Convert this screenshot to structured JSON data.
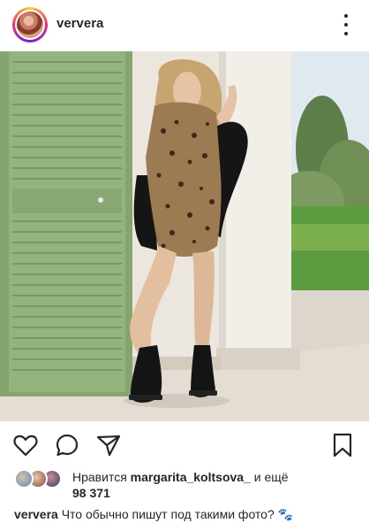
{
  "post": {
    "username": "ververa",
    "more_icon": "more-vertical-icon"
  },
  "actions": {
    "like_icon": "heart-icon",
    "comment_icon": "comment-icon",
    "share_icon": "send-icon",
    "save_icon": "bookmark-icon",
    "tag_icon": "user-tag-icon"
  },
  "likes": {
    "prefix": "Нравится",
    "liked_by": "margarita_koltsova_",
    "suffix": "и ещё",
    "count": "98 371"
  },
  "caption": {
    "author": "ververa",
    "text": "Что обычно пишут под такими фото?",
    "emoji": "🐾"
  },
  "colors": {
    "text": "#262626",
    "shutter_green": "#8fae78",
    "wall": "#ebe7df",
    "lawn": "#5e9a3e"
  }
}
